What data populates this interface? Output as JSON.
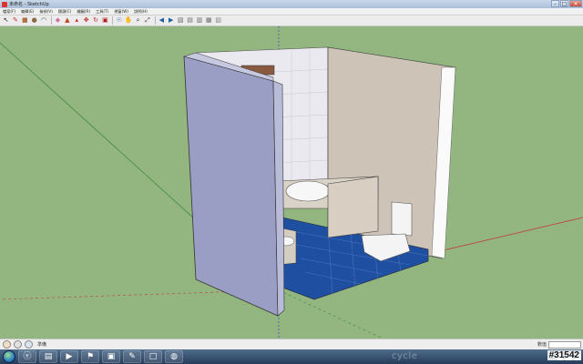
{
  "window": {
    "title": "未命名 - SketchUp",
    "controls": {
      "minimize": "–",
      "maximize": "□",
      "close": "×"
    }
  },
  "menubar": {
    "items": [
      "檔案(F)",
      "編輯(E)",
      "檢視(V)",
      "鏡頭(C)",
      "繪圖(R)",
      "工具(T)",
      "視窗(W)",
      "說明(H)"
    ]
  },
  "toolbar": {
    "tools": [
      {
        "icon": "select-arrow-icon",
        "glyph": "↖",
        "color": "#222222"
      },
      {
        "icon": "pencil-line-icon",
        "glyph": "✎",
        "color": "#c03020"
      },
      {
        "icon": "rectangle-icon",
        "glyph": "■",
        "color": "#b07040"
      },
      {
        "icon": "circle-icon",
        "glyph": "●",
        "color": "#8a6a40"
      },
      {
        "icon": "arc-icon",
        "glyph": "◠",
        "color": "#444444"
      },
      {
        "icon": "eraser-icon",
        "glyph": "◆",
        "color": "#d070a0"
      },
      {
        "icon": "paint-bucket-icon",
        "glyph": "▲",
        "color": "#c04020"
      },
      {
        "icon": "push-pull-icon",
        "glyph": "▴",
        "color": "#d02020"
      },
      {
        "icon": "move-icon",
        "glyph": "✥",
        "color": "#c01818"
      },
      {
        "icon": "rotate-icon",
        "glyph": "↻",
        "color": "#c02020"
      },
      {
        "icon": "offset-icon",
        "glyph": "▣",
        "color": "#b02020"
      },
      {
        "icon": "orbit-icon",
        "glyph": "☉",
        "color": "#2050b0"
      },
      {
        "icon": "pan-hand-icon",
        "glyph": "✋",
        "color": "#404040"
      },
      {
        "icon": "zoom-icon",
        "glyph": "⌕",
        "color": "#303030"
      },
      {
        "icon": "zoom-extents-icon",
        "glyph": "⤢",
        "color": "#404040"
      },
      {
        "icon": "previous-view-icon",
        "glyph": "◀",
        "color": "#2060a0"
      },
      {
        "icon": "next-view-icon",
        "glyph": "▶",
        "color": "#2060a0"
      },
      {
        "icon": "iso-view-icon",
        "glyph": "▧",
        "color": "#6a6a6a"
      },
      {
        "icon": "top-view-icon",
        "glyph": "▤",
        "color": "#6a6a6a"
      },
      {
        "icon": "front-view-icon",
        "glyph": "▥",
        "color": "#6a6a6a"
      },
      {
        "icon": "right-view-icon",
        "glyph": "▦",
        "color": "#6a6a6a"
      },
      {
        "icon": "xray-icon",
        "glyph": "▨",
        "color": "#8a8a8a"
      }
    ]
  },
  "statusbar": {
    "icons": [
      "help-circle-icon",
      "geo-location-icon",
      "credits-icon"
    ],
    "hint_text": "準備",
    "measure_label": "數值"
  },
  "taskbar": {
    "buttons": [
      {
        "name": "ie-browser-icon",
        "glyph": "ⓔ"
      },
      {
        "name": "file-explorer-icon",
        "glyph": "▤"
      },
      {
        "name": "media-player-icon",
        "glyph": "▶"
      },
      {
        "name": "app-green-icon",
        "glyph": "⚑"
      },
      {
        "name": "folder-icon",
        "glyph": "▣"
      },
      {
        "name": "sketchup-icon",
        "glyph": "✎"
      },
      {
        "name": "document-icon",
        "glyph": "□"
      },
      {
        "name": "network-globe-icon",
        "glyph": "◍"
      }
    ],
    "watermark": "cycle",
    "image_id": "#31542"
  },
  "scene": {
    "colors": {
      "ground": "#93b57f",
      "left_wall": "#9a9ec4",
      "floor_tile": "#1f4fa0",
      "back_wall_tile": "#e9e9ef",
      "right_wall": "#cdc3b6",
      "toilet": "#f4f4f4"
    }
  }
}
